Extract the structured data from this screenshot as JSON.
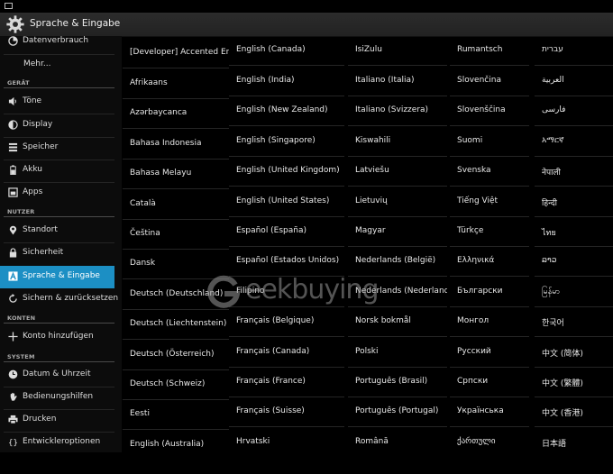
{
  "header": {
    "title": "Sprache & Eingabe",
    "icon": "gear-icon"
  },
  "sidebar": {
    "partial_item": {
      "label": "Datenverbrauch",
      "icon": "data-usage-icon"
    },
    "more_item": {
      "label": "Mehr..."
    },
    "sections": [
      {
        "title": "GERÄT",
        "items": [
          {
            "label": "Töne",
            "icon": "volume-icon"
          },
          {
            "label": "Display",
            "icon": "brightness-icon"
          },
          {
            "label": "Speicher",
            "icon": "storage-icon"
          },
          {
            "label": "Akku",
            "icon": "battery-icon"
          },
          {
            "label": "Apps",
            "icon": "apps-icon"
          }
        ]
      },
      {
        "title": "NUTZER",
        "items": [
          {
            "label": "Standort",
            "icon": "location-icon"
          },
          {
            "label": "Sicherheit",
            "icon": "lock-icon"
          },
          {
            "label": "Sprache & Eingabe",
            "icon": "language-icon",
            "active": true
          },
          {
            "label": "Sichern & zurücksetzen",
            "icon": "backup-icon"
          }
        ]
      },
      {
        "title": "KONTEN",
        "items": [
          {
            "label": "Konto hinzufügen",
            "icon": "plus-icon"
          }
        ]
      },
      {
        "title": "SYSTEM",
        "items": [
          {
            "label": "Datum & Uhrzeit",
            "icon": "clock-icon"
          },
          {
            "label": "Bedienungshilfen",
            "icon": "hand-icon"
          },
          {
            "label": "Drucken",
            "icon": "printer-icon"
          },
          {
            "label": "Entwickleroptionen",
            "icon": "braces-icon"
          }
        ]
      }
    ]
  },
  "languages": {
    "col1": [
      "[Developer] Accented English",
      "Afrikaans",
      "Azərbaycanca",
      "Bahasa Indonesia",
      "Bahasa Melayu",
      "Català",
      "Čeština",
      "Dansk",
      "Deutsch (Deutschland)",
      "Deutsch (Liechtenstein)",
      "Deutsch (Österreich)",
      "Deutsch (Schweiz)",
      "Eesti",
      "English (Australia)"
    ],
    "col2": [
      "English (Canada)",
      "English (India)",
      "English (New Zealand)",
      "English (Singapore)",
      "English (United Kingdom)",
      "English (United States)",
      "Español (España)",
      "Español (Estados Unidos)",
      "Filipino",
      "Français (Belgique)",
      "Français (Canada)",
      "Français (France)",
      "Français (Suisse)",
      "Hrvatski"
    ],
    "col3": [
      "IsiZulu",
      "Italiano (Italia)",
      "Italiano (Svizzera)",
      "Kiswahili",
      "Latviešu",
      "Lietuvių",
      "Magyar",
      "Nederlands (België)",
      "Nederlands (Nederland)",
      "Norsk bokmål",
      "Polski",
      "Português (Brasil)",
      "Português (Portugal)",
      "Română"
    ],
    "col4": [
      "Rumantsch",
      "Slovenčina",
      "Slovenščina",
      "Suomi",
      "Svenska",
      "Tiếng Việt",
      "Türkçe",
      "Ελληνικά",
      "Български",
      "Монгол",
      "Русский",
      "Српски",
      "Українська",
      "ქართული"
    ],
    "col5": [
      "עברית",
      "العربية",
      "فارسی",
      "አማርኛ",
      "नेपाली",
      "हिन्दी",
      "ไทย",
      "ລາວ",
      "မြန်မာ",
      "한국어",
      "中文 (简体)",
      "中文 (繁體)",
      "中文 (香港)",
      "日本語"
    ]
  },
  "watermark": {
    "text": "eekbuying",
    "logo": "geekbuying-g-logo"
  },
  "colors": {
    "accent": "#1c8fc4",
    "background": "#000000",
    "sidebar": "#0c0c0c"
  }
}
